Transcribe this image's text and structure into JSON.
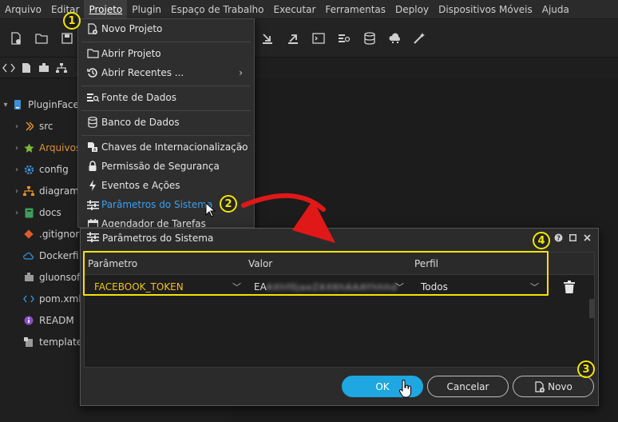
{
  "menubar": {
    "items": [
      "Arquivo",
      "Editar",
      "Projeto",
      "Plugin",
      "Espaço de Trabalho",
      "Executar",
      "Ferramentas",
      "Deploy",
      "Dispositivos Móveis",
      "Ajuda"
    ],
    "active_index": 2
  },
  "tree": {
    "root_label": "PluginFace",
    "items": [
      {
        "label": "src",
        "icon": "source-icon"
      },
      {
        "label": "Arquivos",
        "icon": "star-icon"
      },
      {
        "label": "config",
        "icon": "gear-icon"
      },
      {
        "label": "diagram",
        "icon": "diagram-icon"
      },
      {
        "label": "docs",
        "icon": "book-icon"
      },
      {
        "label": ".gitignor",
        "icon": "git-icon"
      },
      {
        "label": "Dockerfi",
        "icon": "cloud-icon"
      },
      {
        "label": "gluonsof",
        "icon": "puzzle-icon"
      },
      {
        "label": "pom.xml",
        "icon": "code-icon"
      },
      {
        "label": "READM",
        "icon": "info-icon"
      },
      {
        "label": "template",
        "icon": "template-icon"
      }
    ]
  },
  "project_menu": {
    "items": [
      {
        "label": "Novo Projeto",
        "icon": "new-project-icon"
      },
      {
        "label": "Abrir Projeto",
        "icon": "folder-icon"
      },
      {
        "label": "Abrir Recentes ...",
        "icon": "history-icon",
        "submenu": true
      },
      {
        "label": "Fonte de Dados",
        "icon": "datasource-icon"
      },
      {
        "label": "Banco de Dados",
        "icon": "database-icon"
      },
      {
        "label": "Chaves de Internacionalização",
        "icon": "translate-icon",
        "submenu": true
      },
      {
        "label": "Permissão de Segurança",
        "icon": "lock-icon"
      },
      {
        "label": "Eventos e Ações",
        "icon": "lightning-icon"
      },
      {
        "label": "Parâmetros do Sistema",
        "icon": "sliders-icon",
        "highlighted": true
      },
      {
        "label": "Agendador de Tarefas",
        "icon": "calendar-icon"
      }
    ]
  },
  "dialog": {
    "title": "Parâmetros do Sistema",
    "columns": [
      "Parâmetro",
      "Valor",
      "Perfil"
    ],
    "rows": [
      {
        "parametro": "FACEBOOK_TOKEN",
        "valor_prefix": "EA",
        "valor_redacted": "AXhf0jaeZAX6hAAAYhhhd",
        "perfil": "Todos"
      }
    ],
    "buttons": {
      "ok": "OK",
      "cancel": "Cancelar",
      "new": "Novo"
    }
  },
  "annotations": {
    "badges": [
      "1",
      "2",
      "3",
      "4"
    ],
    "colors": {
      "highlight": "#f3e500",
      "arrow": "#e01818",
      "accent": "#1ea7e0",
      "key_text": "#f2c21a"
    }
  }
}
